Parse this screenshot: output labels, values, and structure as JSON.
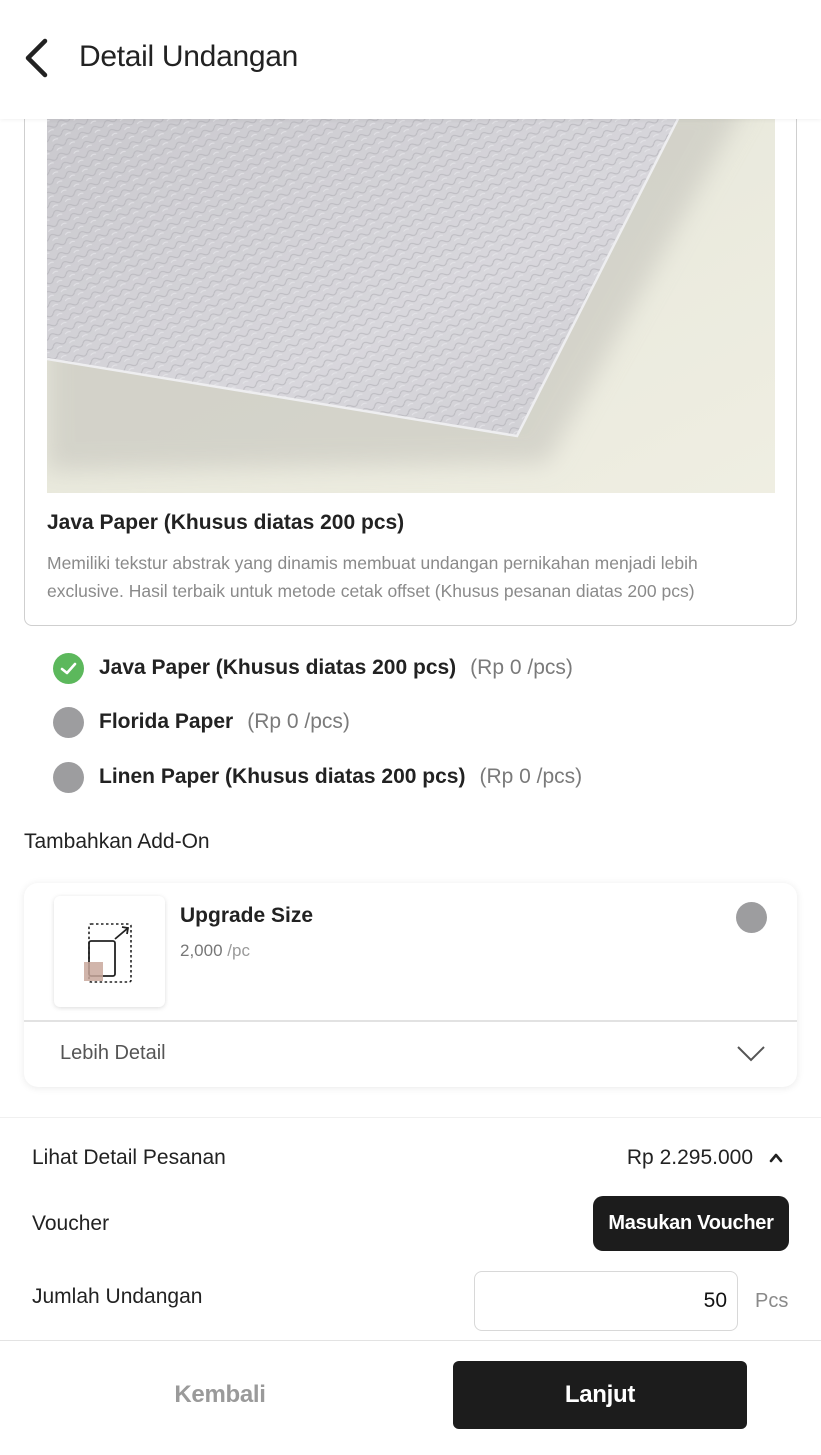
{
  "header": {
    "title": "Detail Undangan"
  },
  "paper_card": {
    "image_icon": "textured-paper-photo",
    "name": "Java Paper (Khusus diatas 200 pcs)",
    "description": "Memiliki tekstur abstrak yang dinamis membuat undangan pernikahan menjadi lebih exclusive. Hasil terbaik untuk metode cetak offset (Khusus pesanan diatas 200 pcs)"
  },
  "paper_options": [
    {
      "name": "Java Paper (Khusus diatas 200 pcs)",
      "price": "(Rp 0 /pcs)",
      "selected": true
    },
    {
      "name": "Florida Paper",
      "price": "(Rp 0 /pcs)",
      "selected": false
    },
    {
      "name": "Linen Paper (Khusus diatas 200 pcs)",
      "price": "(Rp 0 /pcs)",
      "selected": false
    }
  ],
  "addons": {
    "title": "Tambahkan Add-On",
    "items": [
      {
        "name": "Upgrade Size",
        "price": "2,000",
        "unit": "/pc",
        "icon": "upgrade-size-icon",
        "selected": false,
        "more_label": "Lebih Detail"
      }
    ]
  },
  "summary": {
    "detail_label": "Lihat Detail Pesanan",
    "total": "Rp 2.295.000",
    "voucher_label": "Voucher",
    "voucher_button": "Masukan Voucher",
    "quantity_label": "Jumlah Undangan",
    "quantity_value": "50",
    "quantity_unit": "Pcs"
  },
  "footer": {
    "back_label": "Kembali",
    "next_label": "Lanjut"
  },
  "colors": {
    "accent": "#1c1c1c",
    "selected": "#5cb85c",
    "unselected": "#9d9d9f"
  }
}
